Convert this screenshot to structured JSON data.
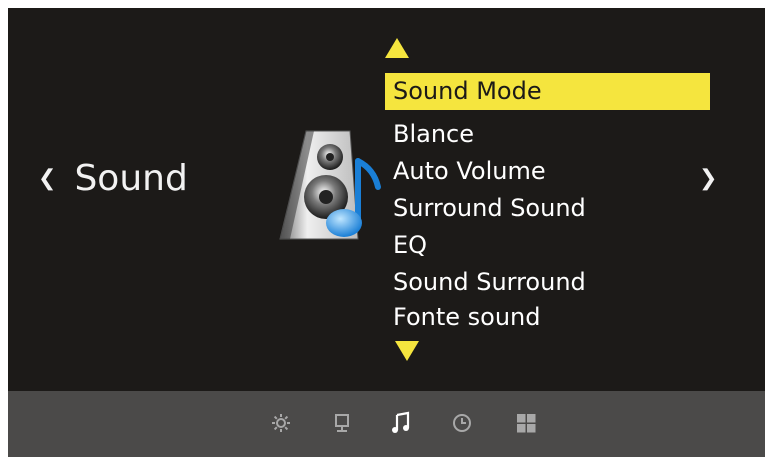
{
  "category": {
    "title": "Sound",
    "prev_glyph": "❮",
    "next_glyph": "❯"
  },
  "menu": {
    "items": [
      {
        "label": "Sound Mode",
        "selected": true
      },
      {
        "label": "Blance",
        "selected": false
      },
      {
        "label": "Auto Volume",
        "selected": false
      },
      {
        "label": "Surround Sound",
        "selected": false
      },
      {
        "label": "EQ",
        "selected": false
      },
      {
        "label": "Sound Surround",
        "selected": false
      },
      {
        "label": "Fonte sound",
        "selected": false
      }
    ]
  },
  "bottom_bar": {
    "icons": [
      {
        "name": "settings-icon",
        "active": false
      },
      {
        "name": "monitor-icon",
        "active": false
      },
      {
        "name": "music-note-icon",
        "active": true
      },
      {
        "name": "clock-icon",
        "active": false
      },
      {
        "name": "grid-icon",
        "active": false
      }
    ]
  },
  "colors": {
    "background": "#1c1a18",
    "highlight": "#f5e53e",
    "bottom_bar": "#4b4a49",
    "text": "#ffffff",
    "icon_inactive": "#a8a8a8",
    "icon_active": "#ffffff"
  }
}
